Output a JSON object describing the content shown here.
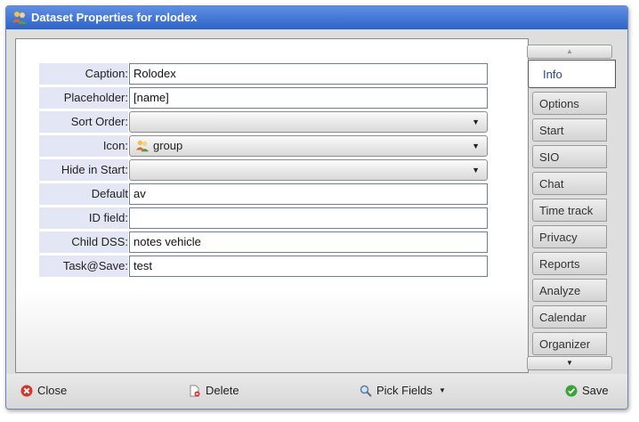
{
  "window": {
    "title": "Dataset Properties for rolodex"
  },
  "form": {
    "caption": {
      "label": "Caption:",
      "value": "Rolodex"
    },
    "placeholder": {
      "label": "Placeholder:",
      "value": "[name]"
    },
    "sort_order": {
      "label": "Sort Order:",
      "value": ""
    },
    "icon": {
      "label": "Icon:",
      "value": "group",
      "icon": "group-icon"
    },
    "hide_in_start": {
      "label": "Hide in Start:",
      "value": ""
    },
    "default": {
      "label": "Default",
      "value": "av"
    },
    "id_field": {
      "label": "ID field:",
      "value": ""
    },
    "child_dss": {
      "label": "Child DSS:",
      "value": "notes vehicle"
    },
    "task_at_save": {
      "label": "Task@Save:",
      "value": "test"
    }
  },
  "tabs": {
    "active": "Info",
    "items": [
      "Info",
      "Options",
      "Start",
      "SIO",
      "Chat",
      "Time track",
      "Privacy",
      "Reports",
      "Analyze",
      "Calendar",
      "Organizer"
    ]
  },
  "footer": {
    "close": "Close",
    "delete": "Delete",
    "pick_fields": "Pick Fields",
    "save": "Save"
  },
  "colors": {
    "title_bar": "#3a6fd8",
    "label_bg": "#e3e6f4",
    "close_icon": "#d8352a",
    "save_icon": "#3aa537"
  }
}
